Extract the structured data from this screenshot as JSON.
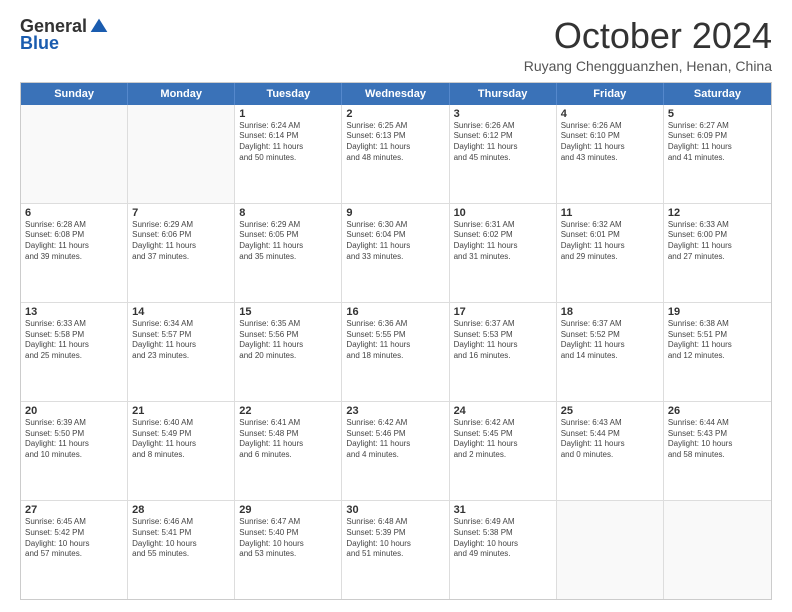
{
  "logo": {
    "general": "General",
    "blue": "Blue"
  },
  "header": {
    "title": "October 2024",
    "subtitle": "Ruyang Chengguanzhen, Henan, China"
  },
  "days": [
    "Sunday",
    "Monday",
    "Tuesday",
    "Wednesday",
    "Thursday",
    "Friday",
    "Saturday"
  ],
  "weeks": [
    [
      {
        "day": "",
        "lines": []
      },
      {
        "day": "",
        "lines": []
      },
      {
        "day": "1",
        "lines": [
          "Sunrise: 6:24 AM",
          "Sunset: 6:14 PM",
          "Daylight: 11 hours",
          "and 50 minutes."
        ]
      },
      {
        "day": "2",
        "lines": [
          "Sunrise: 6:25 AM",
          "Sunset: 6:13 PM",
          "Daylight: 11 hours",
          "and 48 minutes."
        ]
      },
      {
        "day": "3",
        "lines": [
          "Sunrise: 6:26 AM",
          "Sunset: 6:12 PM",
          "Daylight: 11 hours",
          "and 45 minutes."
        ]
      },
      {
        "day": "4",
        "lines": [
          "Sunrise: 6:26 AM",
          "Sunset: 6:10 PM",
          "Daylight: 11 hours",
          "and 43 minutes."
        ]
      },
      {
        "day": "5",
        "lines": [
          "Sunrise: 6:27 AM",
          "Sunset: 6:09 PM",
          "Daylight: 11 hours",
          "and 41 minutes."
        ]
      }
    ],
    [
      {
        "day": "6",
        "lines": [
          "Sunrise: 6:28 AM",
          "Sunset: 6:08 PM",
          "Daylight: 11 hours",
          "and 39 minutes."
        ]
      },
      {
        "day": "7",
        "lines": [
          "Sunrise: 6:29 AM",
          "Sunset: 6:06 PM",
          "Daylight: 11 hours",
          "and 37 minutes."
        ]
      },
      {
        "day": "8",
        "lines": [
          "Sunrise: 6:29 AM",
          "Sunset: 6:05 PM",
          "Daylight: 11 hours",
          "and 35 minutes."
        ]
      },
      {
        "day": "9",
        "lines": [
          "Sunrise: 6:30 AM",
          "Sunset: 6:04 PM",
          "Daylight: 11 hours",
          "and 33 minutes."
        ]
      },
      {
        "day": "10",
        "lines": [
          "Sunrise: 6:31 AM",
          "Sunset: 6:02 PM",
          "Daylight: 11 hours",
          "and 31 minutes."
        ]
      },
      {
        "day": "11",
        "lines": [
          "Sunrise: 6:32 AM",
          "Sunset: 6:01 PM",
          "Daylight: 11 hours",
          "and 29 minutes."
        ]
      },
      {
        "day": "12",
        "lines": [
          "Sunrise: 6:33 AM",
          "Sunset: 6:00 PM",
          "Daylight: 11 hours",
          "and 27 minutes."
        ]
      }
    ],
    [
      {
        "day": "13",
        "lines": [
          "Sunrise: 6:33 AM",
          "Sunset: 5:58 PM",
          "Daylight: 11 hours",
          "and 25 minutes."
        ]
      },
      {
        "day": "14",
        "lines": [
          "Sunrise: 6:34 AM",
          "Sunset: 5:57 PM",
          "Daylight: 11 hours",
          "and 23 minutes."
        ]
      },
      {
        "day": "15",
        "lines": [
          "Sunrise: 6:35 AM",
          "Sunset: 5:56 PM",
          "Daylight: 11 hours",
          "and 20 minutes."
        ]
      },
      {
        "day": "16",
        "lines": [
          "Sunrise: 6:36 AM",
          "Sunset: 5:55 PM",
          "Daylight: 11 hours",
          "and 18 minutes."
        ]
      },
      {
        "day": "17",
        "lines": [
          "Sunrise: 6:37 AM",
          "Sunset: 5:53 PM",
          "Daylight: 11 hours",
          "and 16 minutes."
        ]
      },
      {
        "day": "18",
        "lines": [
          "Sunrise: 6:37 AM",
          "Sunset: 5:52 PM",
          "Daylight: 11 hours",
          "and 14 minutes."
        ]
      },
      {
        "day": "19",
        "lines": [
          "Sunrise: 6:38 AM",
          "Sunset: 5:51 PM",
          "Daylight: 11 hours",
          "and 12 minutes."
        ]
      }
    ],
    [
      {
        "day": "20",
        "lines": [
          "Sunrise: 6:39 AM",
          "Sunset: 5:50 PM",
          "Daylight: 11 hours",
          "and 10 minutes."
        ]
      },
      {
        "day": "21",
        "lines": [
          "Sunrise: 6:40 AM",
          "Sunset: 5:49 PM",
          "Daylight: 11 hours",
          "and 8 minutes."
        ]
      },
      {
        "day": "22",
        "lines": [
          "Sunrise: 6:41 AM",
          "Sunset: 5:48 PM",
          "Daylight: 11 hours",
          "and 6 minutes."
        ]
      },
      {
        "day": "23",
        "lines": [
          "Sunrise: 6:42 AM",
          "Sunset: 5:46 PM",
          "Daylight: 11 hours",
          "and 4 minutes."
        ]
      },
      {
        "day": "24",
        "lines": [
          "Sunrise: 6:42 AM",
          "Sunset: 5:45 PM",
          "Daylight: 11 hours",
          "and 2 minutes."
        ]
      },
      {
        "day": "25",
        "lines": [
          "Sunrise: 6:43 AM",
          "Sunset: 5:44 PM",
          "Daylight: 11 hours",
          "and 0 minutes."
        ]
      },
      {
        "day": "26",
        "lines": [
          "Sunrise: 6:44 AM",
          "Sunset: 5:43 PM",
          "Daylight: 10 hours",
          "and 58 minutes."
        ]
      }
    ],
    [
      {
        "day": "27",
        "lines": [
          "Sunrise: 6:45 AM",
          "Sunset: 5:42 PM",
          "Daylight: 10 hours",
          "and 57 minutes."
        ]
      },
      {
        "day": "28",
        "lines": [
          "Sunrise: 6:46 AM",
          "Sunset: 5:41 PM",
          "Daylight: 10 hours",
          "and 55 minutes."
        ]
      },
      {
        "day": "29",
        "lines": [
          "Sunrise: 6:47 AM",
          "Sunset: 5:40 PM",
          "Daylight: 10 hours",
          "and 53 minutes."
        ]
      },
      {
        "day": "30",
        "lines": [
          "Sunrise: 6:48 AM",
          "Sunset: 5:39 PM",
          "Daylight: 10 hours",
          "and 51 minutes."
        ]
      },
      {
        "day": "31",
        "lines": [
          "Sunrise: 6:49 AM",
          "Sunset: 5:38 PM",
          "Daylight: 10 hours",
          "and 49 minutes."
        ]
      },
      {
        "day": "",
        "lines": []
      },
      {
        "day": "",
        "lines": []
      }
    ]
  ]
}
